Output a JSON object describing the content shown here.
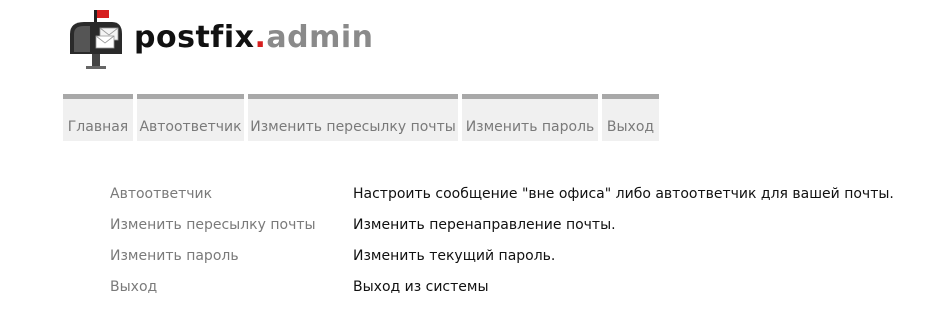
{
  "logo": {
    "part1": "postfix",
    "part2": ".",
    "part3": "admin"
  },
  "nav": {
    "items": [
      {
        "label": "Главная"
      },
      {
        "label": "Автоответчик"
      },
      {
        "label": "Изменить пересылку почты"
      },
      {
        "label": "Изменить пароль"
      },
      {
        "label": "Выход"
      }
    ]
  },
  "menu": {
    "rows": [
      {
        "link": "Автоответчик",
        "description": "Настроить сообщение \"вне офиса\" либо автоответчик для вашей почты."
      },
      {
        "link": "Изменить пересылку почты",
        "description": "Изменить перенаправление почты."
      },
      {
        "link": "Изменить пароль",
        "description": "Изменить текущий пароль."
      },
      {
        "link": "Выход",
        "description": "Выход из системы"
      }
    ]
  },
  "colors": {
    "logo_red": "#d61e1e",
    "logo_gray": "#8a8a8a",
    "nav_background": "#f0f0f0",
    "nav_border": "#a8a8a8",
    "link_gray": "#7a7a7a"
  }
}
